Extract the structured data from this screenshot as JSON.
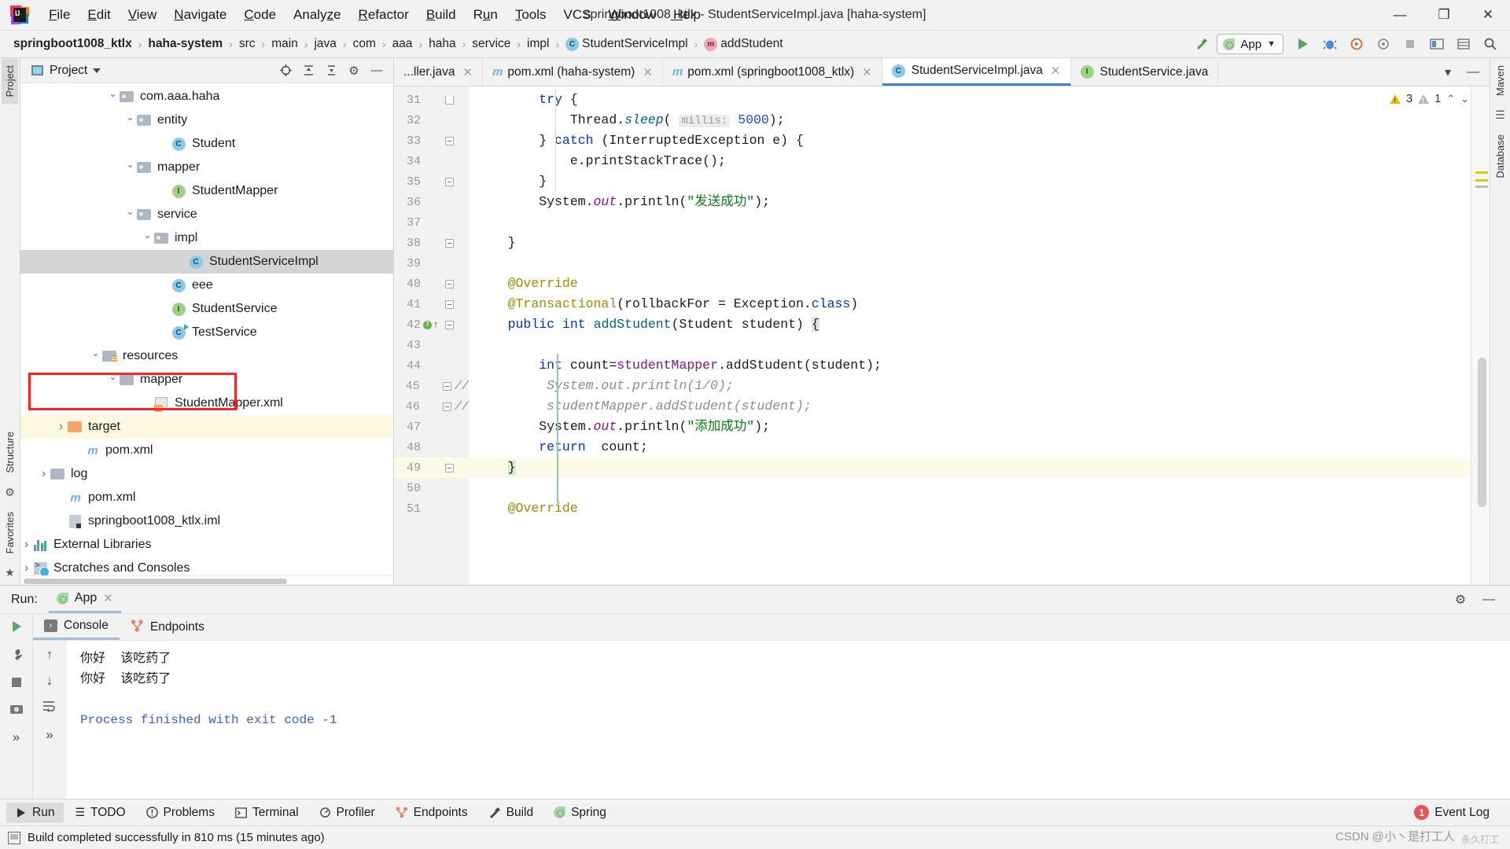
{
  "titlebar": {
    "logo": "intellij-idea-logo",
    "window_title": "springboot1008_ktlx - StudentServiceImpl.java [haha-system]",
    "menus": [
      {
        "label": "File"
      },
      {
        "label": "Edit"
      },
      {
        "label": "View"
      },
      {
        "label": "Navigate"
      },
      {
        "label": "Code"
      },
      {
        "label": "Analyze"
      },
      {
        "label": "Refactor"
      },
      {
        "label": "Build"
      },
      {
        "label": "Run"
      },
      {
        "label": "Tools"
      },
      {
        "label": "VCS"
      },
      {
        "label": "Window"
      },
      {
        "label": "Help"
      }
    ],
    "window_controls": {
      "minimize": "—",
      "maximize": "❐",
      "close": "✕"
    }
  },
  "navbar": {
    "breadcrumbs": [
      {
        "label": "springboot1008_ktlx",
        "bold": true,
        "icon": ""
      },
      {
        "label": "haha-system",
        "bold": true,
        "icon": ""
      },
      {
        "label": "src",
        "bold": false,
        "icon": ""
      },
      {
        "label": "main",
        "bold": false,
        "icon": ""
      },
      {
        "label": "java",
        "bold": false,
        "icon": ""
      },
      {
        "label": "com",
        "bold": false,
        "icon": ""
      },
      {
        "label": "aaa",
        "bold": false,
        "icon": ""
      },
      {
        "label": "haha",
        "bold": false,
        "icon": ""
      },
      {
        "label": "service",
        "bold": false,
        "icon": ""
      },
      {
        "label": "impl",
        "bold": false,
        "icon": ""
      },
      {
        "label": "StudentServiceImpl",
        "bold": false,
        "icon": "class-badge-c"
      },
      {
        "label": "addStudent",
        "bold": false,
        "icon": "method-badge-m"
      }
    ],
    "separator": "›",
    "run_config": {
      "label": "App",
      "icon": "spring-leaf-icon",
      "dropdown": "▾"
    },
    "actions": [
      {
        "name": "build-hammer-icon",
        "glyph": "↖"
      },
      {
        "name": "run-icon",
        "glyph": "▶"
      },
      {
        "name": "debug-icon",
        "glyph": "ὁE"
      },
      {
        "name": "run-with-coverage-icon",
        "glyph": "⟳"
      },
      {
        "name": "profiler-icon",
        "glyph": "◉"
      },
      {
        "name": "stop-icon",
        "glyph": "■"
      },
      {
        "name": "update-app-icon",
        "glyph": "⬚"
      },
      {
        "name": "database-icon",
        "glyph": "☰"
      },
      {
        "name": "search-everywhere-icon",
        "glyph": "⌕"
      }
    ]
  },
  "left_rail": {
    "tabs": [
      {
        "label": "Project",
        "active": true
      },
      {
        "label": "Structure",
        "active": false
      },
      {
        "label": "Favorites",
        "active": false
      }
    ]
  },
  "right_rail": {
    "tabs": [
      {
        "label": "Maven",
        "active": false
      },
      {
        "label": "Database",
        "active": false
      }
    ]
  },
  "project_panel": {
    "title": "Project",
    "dropdown": "▾",
    "actions": [
      {
        "name": "locate-file-icon",
        "glyph": "⊕"
      },
      {
        "name": "expand-all-icon",
        "glyph": "⨌"
      },
      {
        "name": "collapse-all-icon",
        "glyph": "⨍"
      },
      {
        "name": "settings-gear-icon",
        "glyph": "⚙"
      },
      {
        "name": "hide-panel-icon",
        "glyph": "—"
      }
    ],
    "tree": [
      {
        "label": "com.aaa.haha",
        "indent": 5,
        "arrow": "open",
        "icon": "package-folder-icon",
        "state": "normal"
      },
      {
        "label": "entity",
        "indent": 6,
        "arrow": "open",
        "icon": "package-folder-icon",
        "state": "normal"
      },
      {
        "label": "Student",
        "indent": 8,
        "arrow": "blank",
        "icon": "class-badge-c",
        "state": "normal"
      },
      {
        "label": "mapper",
        "indent": 6,
        "arrow": "open",
        "icon": "package-folder-icon",
        "state": "normal"
      },
      {
        "label": "StudentMapper",
        "indent": 8,
        "arrow": "blank",
        "icon": "interface-badge-i",
        "state": "normal"
      },
      {
        "label": "service",
        "indent": 6,
        "arrow": "open",
        "icon": "package-folder-icon",
        "state": "normal"
      },
      {
        "label": "impl",
        "indent": 7,
        "arrow": "open",
        "icon": "package-folder-icon",
        "state": "normal"
      },
      {
        "label": "StudentServiceImpl",
        "indent": 9,
        "arrow": "blank",
        "icon": "class-badge-c",
        "state": "selected"
      },
      {
        "label": "eee",
        "indent": 8,
        "arrow": "blank",
        "icon": "class-badge-c",
        "state": "normal"
      },
      {
        "label": "StudentService",
        "indent": 8,
        "arrow": "blank",
        "icon": "interface-badge-i",
        "state": "normal"
      },
      {
        "label": "TestService",
        "indent": 8,
        "arrow": "blank",
        "icon": "runnable-class-icon",
        "state": "normal"
      },
      {
        "label": "resources",
        "indent": 4,
        "arrow": "open",
        "icon": "resources-folder-icon",
        "state": "normal"
      },
      {
        "label": "mapper",
        "indent": 5,
        "arrow": "open",
        "icon": "plain-folder-icon",
        "state": "normal"
      },
      {
        "label": "StudentMapper.xml",
        "indent": 7,
        "arrow": "blank",
        "icon": "xml-file-icon",
        "state": "normal"
      },
      {
        "label": "target",
        "indent": 2,
        "arrow": "closed",
        "icon": "excluded-folder-icon",
        "state": "highlight"
      },
      {
        "label": "pom.xml",
        "indent": 3,
        "arrow": "blank",
        "icon": "maven-file-icon",
        "state": "normal"
      },
      {
        "label": "log",
        "indent": 1,
        "arrow": "closed",
        "icon": "plain-folder-icon",
        "state": "normal"
      },
      {
        "label": "pom.xml",
        "indent": 2,
        "arrow": "blank",
        "icon": "maven-file-icon",
        "state": "normal"
      },
      {
        "label": "springboot1008_ktlx.iml",
        "indent": 2,
        "arrow": "blank",
        "icon": "iml-file-icon",
        "state": "normal"
      },
      {
        "label": "External Libraries",
        "indent": 0,
        "arrow": "closed",
        "icon": "libraries-icon",
        "state": "normal"
      },
      {
        "label": "Scratches and Consoles",
        "indent": 0,
        "arrow": "closed",
        "icon": "scratches-icon",
        "state": "normal"
      }
    ],
    "annotation": {
      "name": "red-highlight-box",
      "color": "#ff2222"
    }
  },
  "editor": {
    "tabs": [
      {
        "label": "...ller.java",
        "icon": "java-class-icon",
        "active": false
      },
      {
        "label": "pom.xml (haha-system)",
        "icon": "maven-icon",
        "active": false
      },
      {
        "label": "pom.xml (springboot1008_ktlx)",
        "icon": "maven-icon",
        "active": false
      },
      {
        "label": "StudentServiceImpl.java",
        "icon": "class-badge-c",
        "active": true
      },
      {
        "label": "StudentService.java",
        "icon": "interface-badge-i",
        "active": false
      }
    ],
    "tab_close_glyph": "✕",
    "inspection": {
      "warnings": "3",
      "weak_warnings": "1",
      "up_glyph": "⌃",
      "down_glyph": "⌄"
    },
    "lines": [
      {
        "num": "31",
        "fold": "end-open",
        "mark": "",
        "hl": false,
        "tokens": [
          {
            "t": "        ",
            "c": ""
          },
          {
            "t": "try",
            "c": "kw"
          },
          {
            "t": " {",
            "c": ""
          }
        ]
      },
      {
        "num": "32",
        "fold": "",
        "mark": "",
        "hl": false,
        "tokens": [
          {
            "t": "            Thread.",
            "c": ""
          },
          {
            "t": "sleep",
            "c": "mth ital"
          },
          {
            "t": "( ",
            "c": ""
          },
          {
            "t": "millis:",
            "c": "param-hint"
          },
          {
            "t": " ",
            "c": ""
          },
          {
            "t": "5000",
            "c": "num-l"
          },
          {
            "t": ");",
            "c": ""
          }
        ]
      },
      {
        "num": "33",
        "fold": "box",
        "mark": "",
        "hl": false,
        "tokens": [
          {
            "t": "        } ",
            "c": ""
          },
          {
            "t": "catch",
            "c": "kw"
          },
          {
            "t": " (InterruptedException e) {",
            "c": ""
          }
        ]
      },
      {
        "num": "34",
        "fold": "",
        "mark": "",
        "hl": false,
        "tokens": [
          {
            "t": "            e.printStackTrace();",
            "c": ""
          }
        ]
      },
      {
        "num": "35",
        "fold": "box",
        "mark": "",
        "hl": false,
        "tokens": [
          {
            "t": "        }",
            "c": ""
          }
        ]
      },
      {
        "num": "36",
        "fold": "",
        "mark": "",
        "hl": false,
        "tokens": [
          {
            "t": "        System.",
            "c": ""
          },
          {
            "t": "out",
            "c": "fld ital"
          },
          {
            "t": ".println(",
            "c": ""
          },
          {
            "t": "\"发送成功\"",
            "c": "str"
          },
          {
            "t": ");",
            "c": ""
          }
        ]
      },
      {
        "num": "37",
        "fold": "",
        "mark": "",
        "hl": false,
        "tokens": [
          {
            "t": "",
            "c": ""
          }
        ]
      },
      {
        "num": "38",
        "fold": "box",
        "mark": "",
        "hl": false,
        "tokens": [
          {
            "t": "    }",
            "c": ""
          }
        ]
      },
      {
        "num": "39",
        "fold": "",
        "mark": "",
        "hl": false,
        "tokens": [
          {
            "t": "",
            "c": ""
          }
        ]
      },
      {
        "num": "40",
        "fold": "box",
        "mark": "",
        "hl": false,
        "tokens": [
          {
            "t": "    ",
            "c": ""
          },
          {
            "t": "@Override",
            "c": "ann"
          }
        ]
      },
      {
        "num": "41",
        "fold": "box",
        "mark": "",
        "hl": false,
        "tokens": [
          {
            "t": "    ",
            "c": ""
          },
          {
            "t": "@Transactional",
            "c": "ann"
          },
          {
            "t": "(rollbackFor = Exception.",
            "c": ""
          },
          {
            "t": "class",
            "c": "kw"
          },
          {
            "t": ")",
            "c": ""
          }
        ]
      },
      {
        "num": "42",
        "fold": "box",
        "mark": "override-gutter",
        "hl": false,
        "tokens": [
          {
            "t": "    ",
            "c": ""
          },
          {
            "t": "public",
            "c": "kw"
          },
          {
            "t": " ",
            "c": ""
          },
          {
            "t": "int",
            "c": "kw"
          },
          {
            "t": " ",
            "c": ""
          },
          {
            "t": "addStudent",
            "c": "mth"
          },
          {
            "t": "(Student student) ",
            "c": ""
          },
          {
            "t": "{",
            "c": "brace-hl"
          }
        ]
      },
      {
        "num": "43",
        "fold": "",
        "mark": "",
        "hl": false,
        "tokens": [
          {
            "t": "",
            "c": ""
          }
        ]
      },
      {
        "num": "44",
        "fold": "",
        "mark": "",
        "hl": false,
        "tokens": [
          {
            "t": "        ",
            "c": ""
          },
          {
            "t": "int",
            "c": "kw"
          },
          {
            "t": " count=",
            "c": ""
          },
          {
            "t": "studentMapper",
            "c": "fld"
          },
          {
            "t": ".addStudent(student);",
            "c": ""
          }
        ]
      },
      {
        "num": "45",
        "fold": "box-squiggle",
        "mark": "comment-slashes",
        "hl": false,
        "tokens": [
          {
            "t": "         System.out.println(1/0);",
            "c": "cmt"
          }
        ]
      },
      {
        "num": "46",
        "fold": "box",
        "mark": "comment-slashes",
        "hl": false,
        "tokens": [
          {
            "t": "         studentMapper.addStudent(student);",
            "c": "cmt"
          }
        ]
      },
      {
        "num": "47",
        "fold": "",
        "mark": "",
        "hl": false,
        "tokens": [
          {
            "t": "        System.",
            "c": ""
          },
          {
            "t": "out",
            "c": "fld ital"
          },
          {
            "t": ".println(",
            "c": ""
          },
          {
            "t": "\"添加成功\"",
            "c": "str"
          },
          {
            "t": ");",
            "c": ""
          }
        ]
      },
      {
        "num": "48",
        "fold": "",
        "mark": "",
        "hl": false,
        "tokens": [
          {
            "t": "        ",
            "c": ""
          },
          {
            "t": "return",
            "c": "kw"
          },
          {
            "t": "  count;",
            "c": ""
          }
        ]
      },
      {
        "num": "49",
        "fold": "box",
        "mark": "",
        "hl": true,
        "tokens": [
          {
            "t": "    ",
            "c": ""
          },
          {
            "t": "}",
            "c": "brace-hl"
          }
        ]
      },
      {
        "num": "50",
        "fold": "",
        "mark": "",
        "hl": false,
        "tokens": [
          {
            "t": "",
            "c": ""
          }
        ]
      },
      {
        "num": "51",
        "fold": "",
        "mark": "",
        "hl": false,
        "tokens": [
          {
            "t": "    ",
            "c": ""
          },
          {
            "t": "@Override",
            "c": "ann"
          }
        ]
      }
    ]
  },
  "run_panel": {
    "header_label": "Run:",
    "tab": {
      "label": "App",
      "icon": "spring-leaf-icon",
      "close": "✕"
    },
    "header_actions": [
      {
        "name": "settings-gear-icon",
        "glyph": "⚙"
      },
      {
        "name": "hide-panel-icon",
        "glyph": "—"
      }
    ],
    "toolbar": [
      {
        "name": "rerun-icon",
        "glyph": "▶"
      },
      {
        "name": "debug-wrench-icon",
        "glyph": "ὒ7"
      },
      {
        "name": "stop-icon",
        "glyph": "■"
      },
      {
        "name": "camera-icon",
        "glyph": "὏7"
      },
      {
        "name": "more-icon",
        "glyph": "»"
      }
    ],
    "console_tabs": [
      {
        "label": "Console",
        "icon": "console-icon",
        "active": true
      },
      {
        "label": "Endpoints",
        "icon": "endpoints-icon",
        "active": false
      }
    ],
    "side_actions": [
      {
        "name": "scroll-up-icon",
        "glyph": "↑"
      },
      {
        "name": "scroll-down-icon",
        "glyph": "↓"
      },
      {
        "name": "soft-wrap-icon",
        "glyph": "↵"
      },
      {
        "name": "more-icon",
        "glyph": "»"
      }
    ],
    "output": [
      {
        "text": "你好  该吃药了",
        "style": "normal"
      },
      {
        "text": "你好  该吃药了",
        "style": "normal"
      },
      {
        "text": "",
        "style": "normal"
      },
      {
        "text": "Process finished with exit code -1",
        "style": "blue"
      }
    ]
  },
  "tool_window_bar": {
    "left": [
      {
        "label": "Run",
        "icon": "run-icon",
        "active": true
      },
      {
        "label": "TODO",
        "icon": "todo-icon",
        "active": false
      },
      {
        "label": "Problems",
        "icon": "problems-icon",
        "active": false
      },
      {
        "label": "Terminal",
        "icon": "terminal-icon",
        "active": false
      },
      {
        "label": "Profiler",
        "icon": "profiler-icon",
        "active": false
      },
      {
        "label": "Endpoints",
        "icon": "endpoints-icon",
        "active": false
      },
      {
        "label": "Build",
        "icon": "build-hammer-icon",
        "active": false
      },
      {
        "label": "Spring",
        "icon": "spring-leaf-icon",
        "active": false
      }
    ],
    "right": [
      {
        "label": "Event Log",
        "icon": "event-log-badge",
        "badge": "1"
      }
    ]
  },
  "status_bar": {
    "message": "Build completed successfully in 810 ms (15 minutes ago)",
    "icon": "build-status-icon",
    "watermark": "CSDN @小丶是打工人",
    "watermark2": "永久打工"
  }
}
